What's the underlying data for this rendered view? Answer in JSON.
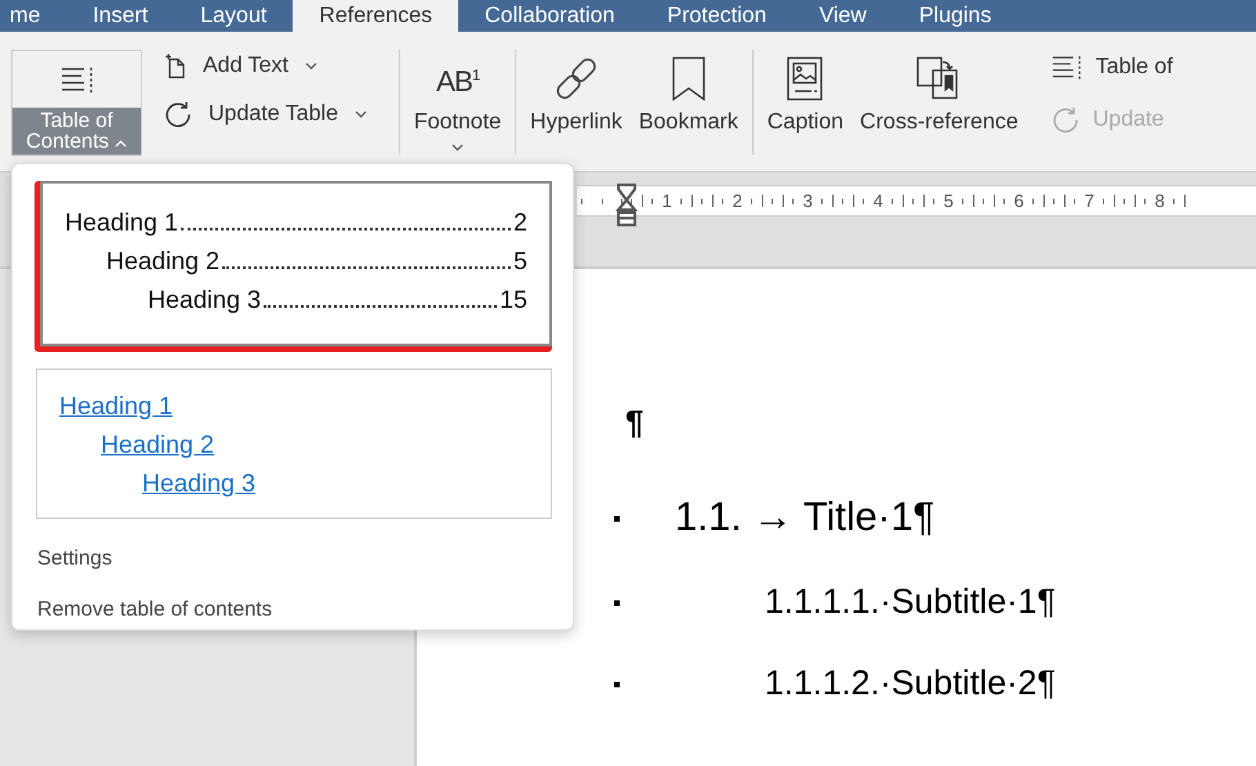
{
  "ribbon_tabs": [
    {
      "label": "me",
      "selected": false
    },
    {
      "label": "Insert",
      "selected": false
    },
    {
      "label": "Layout",
      "selected": false
    },
    {
      "label": "References",
      "selected": true
    },
    {
      "label": "Collaboration",
      "selected": false
    },
    {
      "label": "Protection",
      "selected": false
    },
    {
      "label": "View",
      "selected": false
    },
    {
      "label": "Plugins",
      "selected": false
    }
  ],
  "toolbar": {
    "toc_button": {
      "label": "Table of Contents",
      "expanded": true
    },
    "small_buttons": [
      {
        "kind": "add",
        "label": "Add Text"
      },
      {
        "kind": "update",
        "label": "Update Table"
      }
    ],
    "groups": [
      [
        {
          "kind": "footnote",
          "label": "Footnote",
          "icon_text": "AB",
          "icon_sup": "1",
          "dropdown": true
        }
      ],
      [
        {
          "kind": "hyperlink",
          "label": "Hyperlink",
          "dropdown": false
        },
        {
          "kind": "bookmark",
          "label": "Bookmark",
          "dropdown": false
        }
      ],
      [
        {
          "kind": "caption",
          "label": "Caption",
          "dropdown": false
        },
        {
          "kind": "crossref",
          "label": "Cross-reference",
          "dropdown": false
        }
      ]
    ],
    "right_buttons": [
      {
        "kind": "toc",
        "label": "Table of",
        "disabled": false
      },
      {
        "kind": "update",
        "label": "Update",
        "disabled": true
      }
    ]
  },
  "ruler_marks": [
    "1",
    "2",
    "3",
    "4",
    "5",
    "6",
    "7",
    "8"
  ],
  "document": {
    "empty_paragraph": "¶",
    "items": [
      {
        "text": "1.1. → Title·1¶",
        "children": [
          {
            "text": "1.1.1.1.·Subtitle·1¶"
          },
          {
            "text": "1.1.1.2.·Subtitle·2¶"
          }
        ]
      }
    ]
  },
  "toc_menu": {
    "styles": [
      {
        "kind": "dotted",
        "selected": true,
        "entries": [
          {
            "text": "Heading 1",
            "page": "2",
            "children": [
              {
                "text": "Heading 2",
                "page": "5",
                "children": [
                  {
                    "text": "Heading 3",
                    "page": "15"
                  }
                ]
              }
            ]
          }
        ]
      },
      {
        "kind": "links",
        "selected": false,
        "entries": [
          {
            "text": "Heading 1",
            "children": [
              {
                "text": "Heading 2",
                "children": [
                  {
                    "text": "Heading 3"
                  }
                ]
              }
            ]
          }
        ]
      }
    ],
    "items": [
      "Settings",
      "Remove table of contents"
    ]
  }
}
